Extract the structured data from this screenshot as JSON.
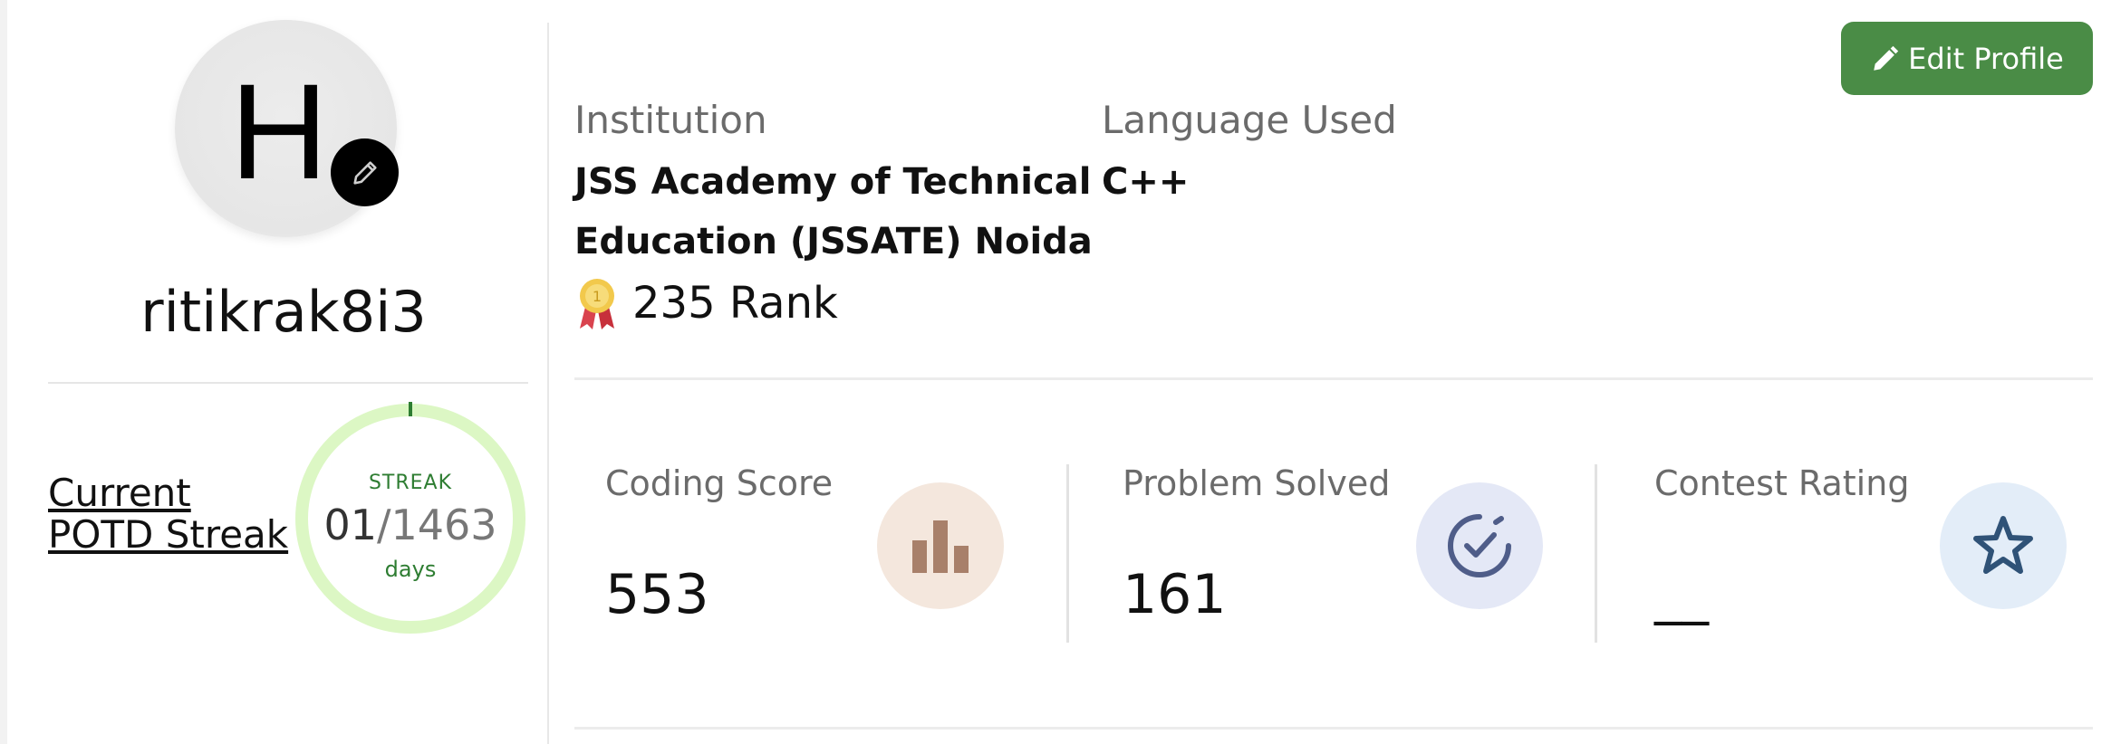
{
  "profile": {
    "avatar_letter": "H",
    "username": "ritikrak8i3"
  },
  "streak": {
    "label_line1": "Current",
    "label_line2": "POTD Streak",
    "caption": "STREAK",
    "current": "01",
    "slash": "/",
    "total": "1463",
    "unit": "days",
    "progress_fraction": 0.0007,
    "ring_color": "#dcf7c4",
    "progress_color": "#2e7d32"
  },
  "info": {
    "institution_label": "Institution",
    "institution_line1": "JSS Academy of Technical",
    "institution_line2": "Education (JSSATE) Noida",
    "language_label": "Language Used",
    "language_value": "C++",
    "rank_text": "235 Rank",
    "rank_icon": "medal-icon"
  },
  "edit_button": {
    "label": "Edit Profile",
    "icon": "pencil-icon",
    "color": "#4a8c46"
  },
  "stats": [
    {
      "label": "Coding Score",
      "value": "553",
      "icon": "bar-chart-icon",
      "icon_bg": "#f5e6dc"
    },
    {
      "label": "Problem Solved",
      "value": "161",
      "icon": "check-circle-icon",
      "icon_bg": "#e3e8f7"
    },
    {
      "label": "Contest Rating",
      "value": "__",
      "icon": "star-icon",
      "icon_bg": "#e4eef8"
    }
  ]
}
